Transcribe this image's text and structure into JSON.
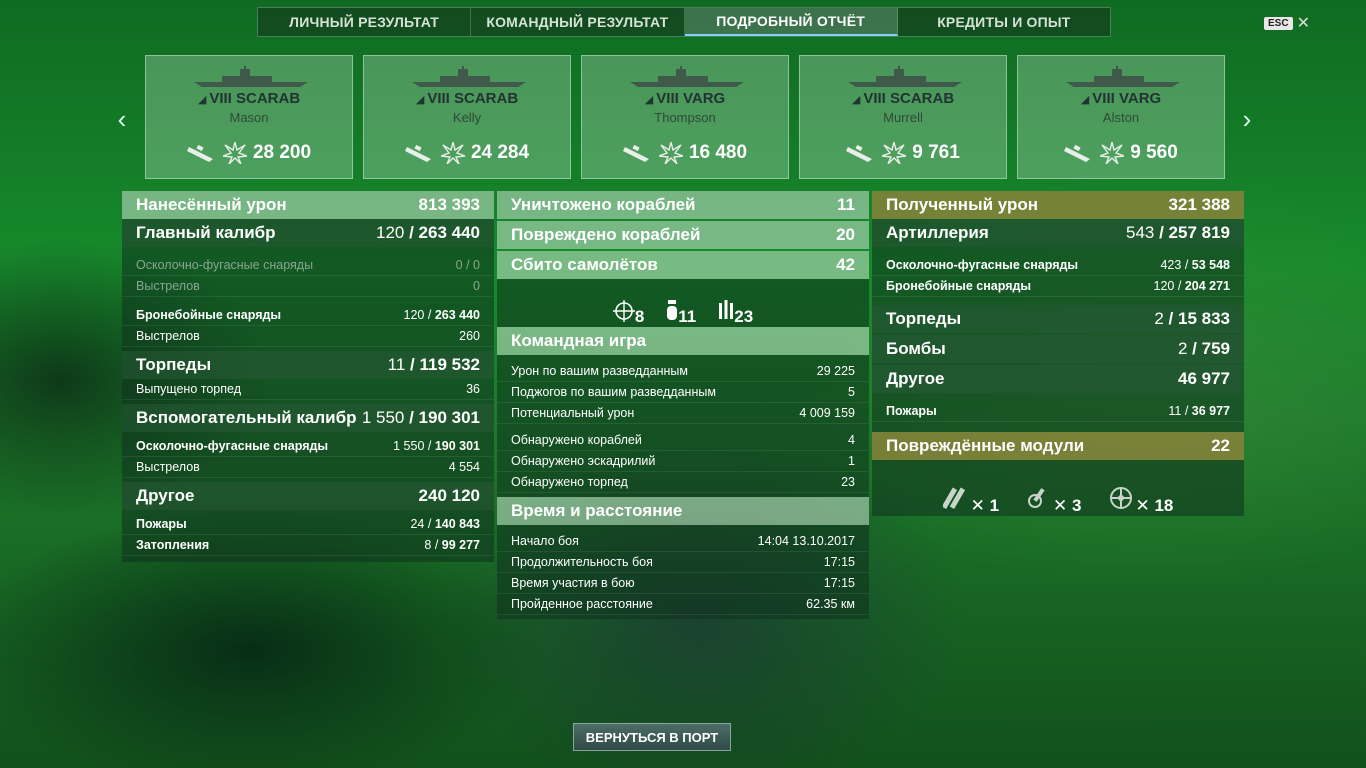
{
  "tabs": [
    "ЛИЧНЫЙ РЕЗУЛЬТАТ",
    "КОМАНДНЫЙ РЕЗУЛЬТАТ",
    "ПОДРОБНЫЙ ОТЧЁТ",
    "КРЕДИТЫ И ОПЫТ"
  ],
  "active_tab": "ПОДРОБНЫЙ ОТЧЁТ",
  "esc_label": "ESC",
  "ships": [
    {
      "tier": "VIII",
      "name": "SCARAB",
      "player": "Mason",
      "damage": "28 200"
    },
    {
      "tier": "VIII",
      "name": "SCARAB",
      "player": "Kelly",
      "damage": "24 284"
    },
    {
      "tier": "VIII",
      "name": "VARG",
      "player": "Thompson",
      "damage": "16 480"
    },
    {
      "tier": "VIII",
      "name": "SCARAB",
      "player": "Murrell",
      "damage": "9 761"
    },
    {
      "tier": "VIII",
      "name": "VARG",
      "player": "Alston",
      "damage": "9 560"
    }
  ],
  "left": {
    "dealt_label": "Нанесённый урон",
    "dealt_value": "813 393",
    "main_label": "Главный калибр",
    "main_hits": "120",
    "main_value": "263 440",
    "main_he_label": "Осколочно-фугасные снаряды",
    "main_he_value": "0 / 0",
    "main_he_shots_label": "Выстрелов",
    "main_he_shots": "0",
    "main_ap_label": "Бронебойные снаряды",
    "main_ap_hits": "120",
    "main_ap_value": "263 440",
    "main_ap_shots_label": "Выстрелов",
    "main_ap_shots": "260",
    "torp_label": "Торпеды",
    "torp_hits": "11",
    "torp_value": "119 532",
    "torp_launched_label": "Выпущено торпед",
    "torp_launched": "36",
    "sec_label": "Вспомогательный калибр",
    "sec_hits": "1 550",
    "sec_value": "190 301",
    "sec_he_label": "Осколочно-фугасные снаряды",
    "sec_he_hits": "1 550",
    "sec_he_value": "190 301",
    "sec_shots_label": "Выстрелов",
    "sec_shots": "4 554",
    "other_label": "Другое",
    "other_value": "240 120",
    "fires_label": "Пожары",
    "fires_count": "24",
    "fires_value": "140 843",
    "flood_label": "Затопления",
    "flood_count": "8",
    "flood_value": "99 277"
  },
  "mid": {
    "destroyed_label": "Уничтожено кораблей",
    "destroyed_value": "11",
    "damaged_label": "Повреждено кораблей",
    "damaged_value": "20",
    "planes_label": "Сбито самолётов",
    "planes_value": "42",
    "plane_icons": [
      {
        "icon": "crosshair-plane-icon",
        "value": "8"
      },
      {
        "icon": "bomb-icon",
        "value": "11"
      },
      {
        "icon": "rockets-icon",
        "value": "23"
      }
    ],
    "team_label": "Командная игра",
    "team_rows": [
      {
        "label": "Урон по вашим разведданным",
        "value": "29 225"
      },
      {
        "label": "Поджогов по вашим разведданным",
        "value": "5"
      },
      {
        "label": "Потенциальный урон",
        "value": "4 009 159"
      }
    ],
    "spot_rows": [
      {
        "label": "Обнаружено кораблей",
        "value": "4"
      },
      {
        "label": "Обнаружено эскадрилий",
        "value": "1"
      },
      {
        "label": "Обнаружено торпед",
        "value": "23"
      }
    ],
    "time_label": "Время и расстояние",
    "time_rows": [
      {
        "label": "Начало боя",
        "value": "14:04  13.10.2017"
      },
      {
        "label": "Продолжительность боя",
        "value": "17:15"
      },
      {
        "label": "Время участия в бою",
        "value": "17:15"
      },
      {
        "label": "Пройденное расстояние",
        "value": "62.35 км"
      }
    ]
  },
  "right": {
    "recv_label": "Полученный урон",
    "recv_value": "321 388",
    "art_label": "Артиллерия",
    "art_hits": "543",
    "art_value": "257 819",
    "he_label": "Осколочно-фугасные снаряды",
    "he_hits": "423",
    "he_value": "53 548",
    "ap_label": "Бронебойные снаряды",
    "ap_hits": "120",
    "ap_value": "204 271",
    "torp_label": "Торпеды",
    "torp_hits": "2",
    "torp_value": "15 833",
    "bomb_label": "Бомбы",
    "bomb_hits": "2",
    "bomb_value": "759",
    "other_label": "Другое",
    "other_value": "46 977",
    "fires_label": "Пожары",
    "fires_count": "11",
    "fires_value": "36 977",
    "modules_label": "Повреждённые модули",
    "modules_value": "22",
    "module_icons": [
      {
        "icon": "gun-module-icon",
        "value": "1"
      },
      {
        "icon": "aa-module-icon",
        "value": "3"
      },
      {
        "icon": "steering-module-icon",
        "value": "18"
      }
    ]
  },
  "return_button": "ВЕРНУТЬСЯ В ПОРТ",
  "colors": {
    "accent_gold": "#96823c",
    "active_tab_underline": "#7fd2ff"
  }
}
